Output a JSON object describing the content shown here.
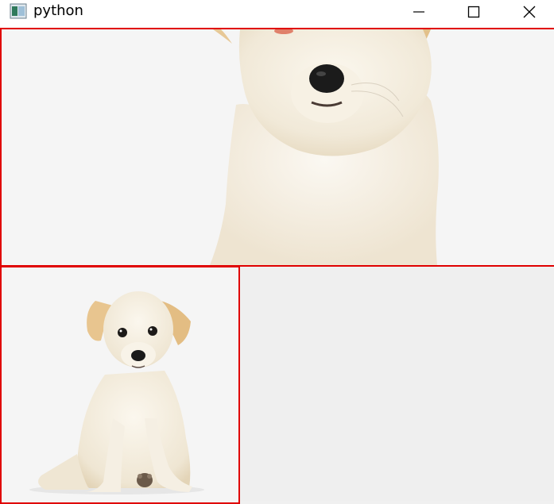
{
  "window": {
    "title": "python",
    "icon": "python-app-icon",
    "controls": {
      "minimize_icon": "minimize-icon",
      "maximize_icon": "maximize-icon",
      "close_icon": "close-icon"
    }
  },
  "panels": {
    "top_image": {
      "subject": "puppy-zoomed"
    },
    "bottom_left_image": {
      "subject": "puppy-full"
    }
  },
  "colors": {
    "panel_border": "#e00000",
    "titlebar_bg": "#ffffff",
    "window_bg": "#f0f0f0"
  }
}
